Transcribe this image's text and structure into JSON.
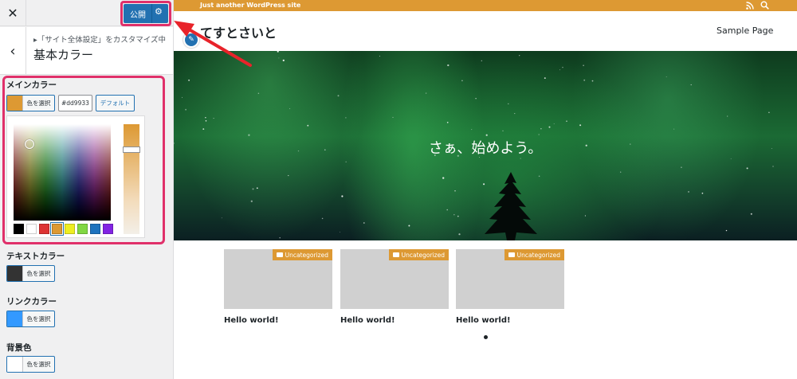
{
  "customizer": {
    "close_icon": "close-icon",
    "publish_label": "公開",
    "publish_gear_icon": "gear-icon",
    "back_icon": "chevron-left-icon",
    "breadcrumb": "▸「サイト全体設定」をカスタマイズ中",
    "section_title": "基本カラー",
    "main_color": {
      "label": "メインカラー",
      "swatch": "#dd9933",
      "button_text": "色を選択",
      "hex_value": "#dd9933",
      "default_label": "デフォルト",
      "palette": [
        "#000000",
        "#ffffff",
        "#dd3333",
        "#dd9933",
        "#eeee22",
        "#81d742",
        "#1e73be",
        "#8224e3"
      ],
      "selected_palette_index": 3
    },
    "text_color": {
      "label": "テキストカラー",
      "swatch": "#333333",
      "button_text": "色を選択"
    },
    "link_color": {
      "label": "リンクカラー",
      "swatch": "#3399ff",
      "button_text": "色を選択"
    },
    "background_color": {
      "label": "背景色",
      "swatch": "#ffffff",
      "button_text": "色を選択"
    }
  },
  "site": {
    "tagline": "Just another WordPress site",
    "title": "てすとさいと",
    "nav": [
      "Sample Page"
    ],
    "hero_text": "さぁ、始めよう。",
    "accent": "#dd9933",
    "posts": [
      {
        "category": "Uncategorized",
        "title": "Hello world!"
      },
      {
        "category": "Uncategorized",
        "title": "Hello world!"
      },
      {
        "category": "Uncategorized",
        "title": "Hello world!"
      }
    ]
  },
  "annotation": {
    "color": "#e0306a"
  }
}
